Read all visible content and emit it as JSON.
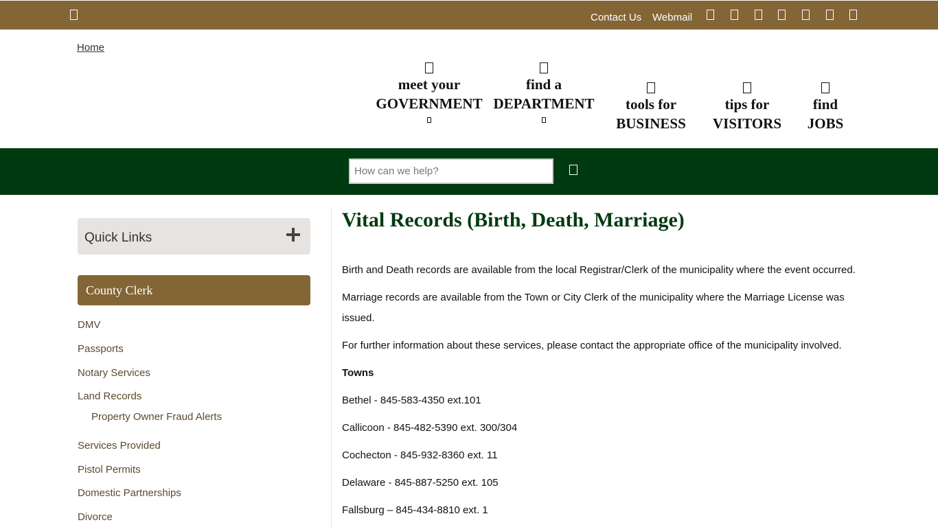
{
  "topbar": {
    "menu_icon": "hamburger-icon",
    "links": {
      "contact": "Contact Us",
      "webmail": "Webmail"
    },
    "social_icons": [
      "facebook-icon",
      "twitter-icon",
      "youtube-icon",
      "instagram-icon",
      "linkedin-icon",
      "rss-icon",
      "translate-icon"
    ]
  },
  "header": {
    "logo_alt": "Home",
    "nav": [
      {
        "line1": "meet your",
        "line2": "GOVERNMENT",
        "icon": "government-icon",
        "has_dropdown": true
      },
      {
        "line1": "find a",
        "line2": "DEPARTMENT",
        "icon": "department-icon",
        "has_dropdown": true
      },
      {
        "line1": "tools for",
        "line2": "BUSINESS",
        "icon": "business-icon",
        "has_dropdown": false
      },
      {
        "line1": "tips for",
        "line2": "VISITORS",
        "icon": "visitors-icon",
        "has_dropdown": false
      },
      {
        "line1": "find",
        "line2": "JOBS",
        "icon": "jobs-icon",
        "has_dropdown": false
      }
    ]
  },
  "search": {
    "placeholder": "How can we help?",
    "value": "",
    "icon": "search-icon"
  },
  "sidebar": {
    "quick_links": "Quick Links",
    "section_title": "County Clerk",
    "links": [
      "DMV",
      "Passports",
      "Notary Services",
      "Land Records",
      "Property Owner Fraud Alerts",
      "Services Provided",
      "Pistol Permits",
      "Domestic Partnerships",
      "Divorce"
    ]
  },
  "content": {
    "title": "Vital Records (Birth, Death, Marriage)",
    "paragraphs": [
      "Birth and Death records are available from the local Registrar/Clerk of the municipality where the event occurred.",
      "Marriage records are available from the Town or City Clerk of the municipality where the Marriage License was issued.",
      "For further information about these services, please contact the appropriate office of the municipality involved."
    ],
    "towns_heading": "Towns",
    "towns": [
      "Bethel -  845-583-4350 ext.101",
      "Callicoon -  845-482-5390 ext. 300/304",
      "Cochecton -  845-932-8360 ext. 11",
      "Delaware -  845-887-5250 ext. 105",
      "Fallsburg – 845-434-8810 ext. 1"
    ]
  },
  "colors": {
    "brand_brown": "#846535",
    "brand_green": "#003a10"
  }
}
